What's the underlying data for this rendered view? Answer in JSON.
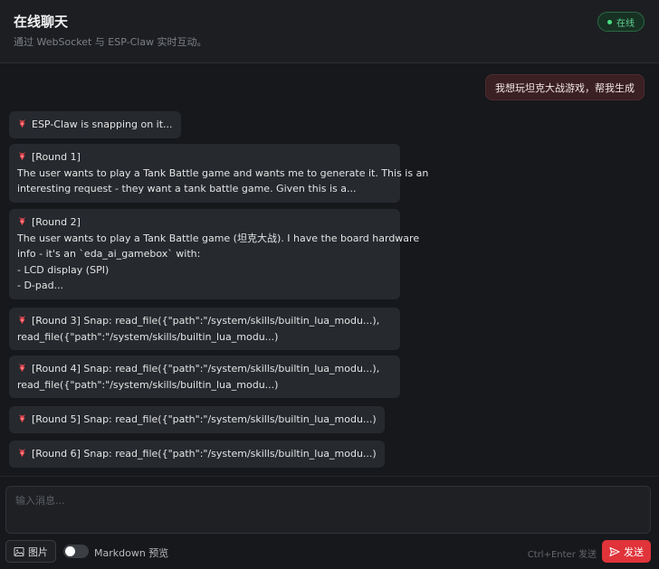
{
  "header": {
    "title": "在线聊天",
    "subtitle": "通过 WebSocket 与 ESP-Claw 实时互动。",
    "status": "在线"
  },
  "messages": {
    "user": "我想玩坦克大战游戏，帮我生成",
    "bot": [
      {
        "lines": [
          "ESP-Claw is snapping on it..."
        ]
      },
      {
        "lines": [
          "[Round 1]",
          "The user wants to play a Tank Battle game and wants me to generate it. This is an",
          "interesting request - they want a tank battle game. Given this is a..."
        ]
      },
      {
        "lines": [
          "[Round 2]",
          "The user wants to play a Tank Battle game (坦克大战). I have the board hardware",
          "info - it's an `eda_ai_gamebox` with:",
          "- LCD display (SPI)",
          "- D-pad..."
        ]
      },
      {
        "lines": [
          "[Round 3] Snap: read_file({\"path\":\"/system/skills/builtin_lua_modu...),",
          "read_file({\"path\":\"/system/skills/builtin_lua_modu...)"
        ]
      },
      {
        "lines": [
          "[Round 4] Snap: read_file({\"path\":\"/system/skills/builtin_lua_modu...),",
          "read_file({\"path\":\"/system/skills/builtin_lua_modu...)"
        ]
      },
      {
        "lines": [
          "[Round 5] Snap: read_file({\"path\":\"/system/skills/builtin_lua_modu...)"
        ]
      },
      {
        "lines": [
          "[Round 6] Snap: read_file({\"path\":\"/system/skills/builtin_lua_modu...)"
        ]
      }
    ]
  },
  "composer": {
    "placeholder": "输入消息...",
    "image_label": "图片",
    "markdown_label": "Markdown 预览",
    "hint": "Ctrl+Enter 发送",
    "send_label": "发送"
  },
  "icons": {
    "bot": "claw-icon",
    "image": "image-icon",
    "send": "send-icon"
  },
  "colors": {
    "accent": "#e0333a",
    "online": "#4ade80",
    "user_bubble": "#3a1f23",
    "bot_bubble": "#26292e"
  }
}
